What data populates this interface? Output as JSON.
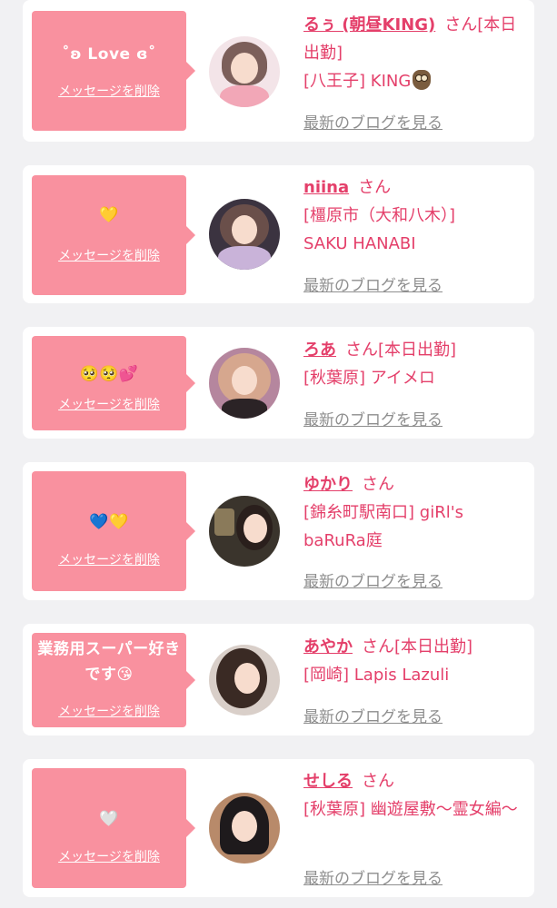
{
  "colors": {
    "accent": "#e43f6a",
    "bubble": "#f9919f",
    "muted": "#8e8e8e"
  },
  "delete_label": "メッセージを削除",
  "blog_label": "最新のブログを見る",
  "cards": [
    {
      "message": "˚ʚ Love ɞ˚",
      "name": "るぅ (朝昼KING)",
      "suffix": "さん[本日出勤]",
      "shop": "[八王子] KING",
      "shop_icon": "owl-icon"
    },
    {
      "message": "💛",
      "name": "niina",
      "suffix": "さん",
      "shop": "[橿原市（大和八木）] SAKU HANABI"
    },
    {
      "message": "🥺🥺💕",
      "name": "ろあ",
      "suffix": "さん[本日出勤]",
      "shop": "[秋葉原] アイメロ"
    },
    {
      "message": "💙💛",
      "name": "ゆかり",
      "suffix": "さん",
      "shop": "[錦糸町駅南口] giRl's baRuRa庭"
    },
    {
      "message": "業務用スーパー好きです😘",
      "name": "あやか",
      "suffix": "さん[本日出勤]",
      "shop": "[岡崎] Lapis Lazuli"
    },
    {
      "message": "🤍",
      "name": "せしる",
      "suffix": "さん",
      "shop": "[秋葉原] 幽遊屋敷〜霊女編〜"
    }
  ]
}
